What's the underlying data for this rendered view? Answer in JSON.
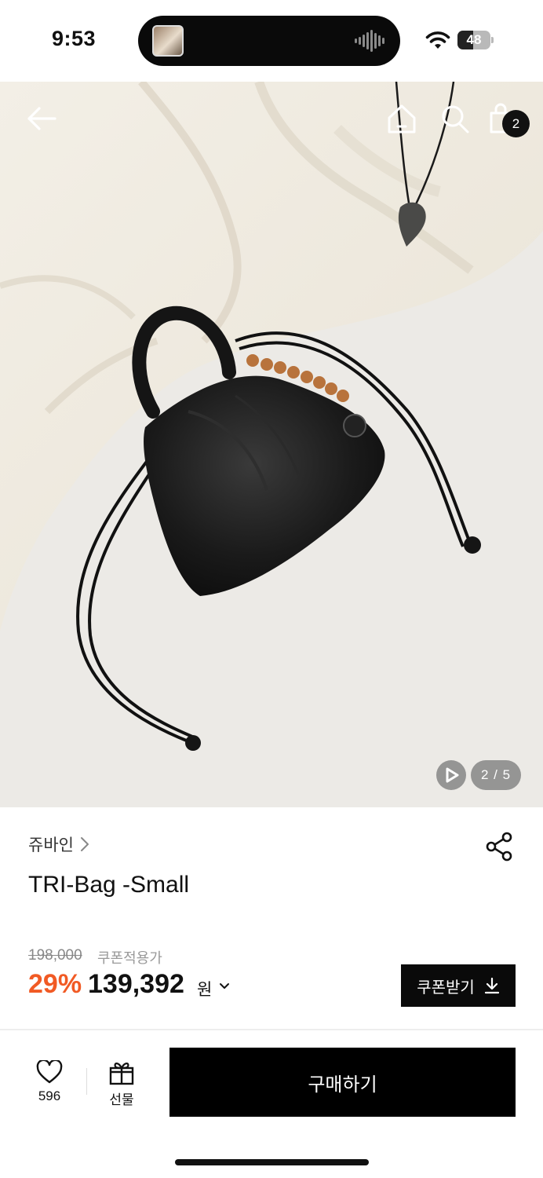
{
  "status_bar": {
    "time": "9:53",
    "battery_level": "48",
    "battery_fraction": 0.48
  },
  "nav": {
    "cart_count": "2",
    "icons": [
      "back-arrow-icon",
      "home-icon",
      "search-icon",
      "shopping-bag-icon"
    ]
  },
  "gallery": {
    "page_indicator": "2 / 5",
    "current_image": 2,
    "total_images": 5
  },
  "product": {
    "brand": "쥬바인",
    "title": "TRI-Bag -Small",
    "original_price": "198,000",
    "coupon_note": "쿠폰적용가",
    "discount_rate": "29%",
    "sale_price": "139,392",
    "currency": "원"
  },
  "coupon": {
    "button_label": "쿠폰받기"
  },
  "bottom_bar": {
    "like_count": "596",
    "gift_label": "선물",
    "buy_label": "구매하기"
  },
  "colors": {
    "accent_discount": "#f15a24",
    "primary_black": "#000000"
  }
}
